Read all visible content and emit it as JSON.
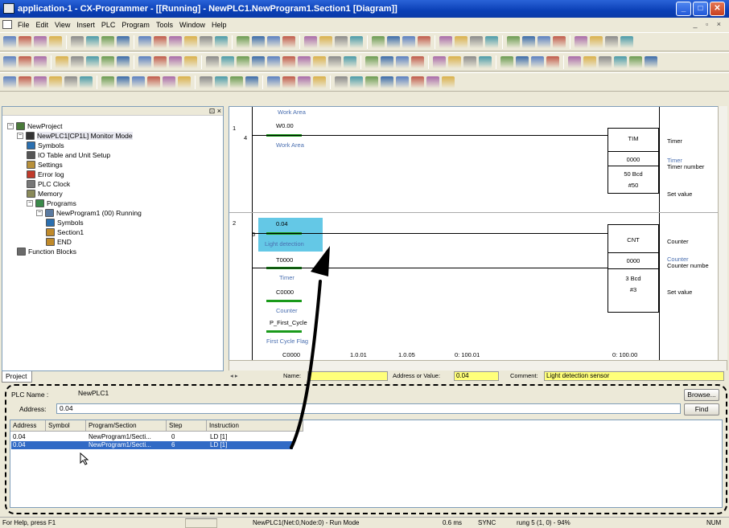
{
  "window": {
    "title": "application-1 - CX-Programmer - [[Running] - NewPLC1.NewProgram1.Section1 [Diagram]]",
    "controls": [
      "minimize",
      "maximize",
      "close"
    ]
  },
  "menu": [
    "File",
    "Edit",
    "View",
    "Insert",
    "PLC",
    "Program",
    "Tools",
    "Window",
    "Help"
  ],
  "tree": {
    "items": [
      {
        "label": "NewProject",
        "level": 0,
        "expanded": true,
        "icon": "project-icon"
      },
      {
        "label": "NewPLC1[CP1L] Monitor Mode",
        "level": 1,
        "expanded": true,
        "icon": "plc-icon"
      },
      {
        "label": "Symbols",
        "level": 2,
        "icon": "symbols-icon"
      },
      {
        "label": "IO Table and Unit Setup",
        "level": 2,
        "icon": "io-table-icon"
      },
      {
        "label": "Settings",
        "level": 2,
        "icon": "settings-icon"
      },
      {
        "label": "Error log",
        "level": 2,
        "icon": "error-log-icon"
      },
      {
        "label": "PLC Clock",
        "level": 2,
        "icon": "clock-icon"
      },
      {
        "label": "Memory",
        "level": 2,
        "icon": "memory-icon"
      },
      {
        "label": "Programs",
        "level": 2,
        "expanded": true,
        "icon": "programs-icon"
      },
      {
        "label": "NewProgram1 (00) Running",
        "level": 3,
        "expanded": true,
        "icon": "program-icon"
      },
      {
        "label": "Symbols",
        "level": 4,
        "icon": "symbols-icon"
      },
      {
        "label": "Section1",
        "level": 4,
        "icon": "section-icon"
      },
      {
        "label": "END",
        "level": 4,
        "icon": "end-icon"
      },
      {
        "label": "Function Blocks",
        "level": 1,
        "icon": "function-blocks-icon"
      }
    ],
    "tab": "Project"
  },
  "ladder": {
    "header_label": "Work Area",
    "rung1": {
      "rung_no": "1",
      "step": "4",
      "contact_addr": "W0.00",
      "contact_comment": "Work Area",
      "block": {
        "name": "TIM",
        "number": "0000",
        "bcd": "50 Bcd",
        "sv": "#50"
      },
      "right_labels": [
        "Timer",
        "Timer",
        "Timer number",
        "Set value"
      ]
    },
    "rung2": {
      "rung_no": "2",
      "step": "6",
      "contact1_addr": "0.04",
      "contact1_comment": "Light detection",
      "contact2_addr": "T0000",
      "contact2_comment": "Timer",
      "contact3_addr": "C0000",
      "contact3_comment": "Counter",
      "contact4_addr": "P_First_Cycle",
      "contact4_comment": "First Cycle Flag",
      "block": {
        "name": "CNT",
        "number": "0000",
        "bcd": "3 Bcd",
        "sv": "#3"
      },
      "right_labels": [
        "Counter",
        "Counter",
        "Counter numbe",
        "Set value"
      ]
    },
    "bottom_row": [
      "C0000",
      "1.0.01",
      "1.0.05",
      "0: 100.01",
      "0: 100.00"
    ]
  },
  "infobar": {
    "name_label": "Name:",
    "name_value": "",
    "address_label": "Address or Value:",
    "address_value": "0.04",
    "comment_label": "Comment:",
    "comment_value": "Light detection sensor"
  },
  "search": {
    "plc_name_label": "PLC Name :",
    "plc_name_value": "NewPLC1",
    "address_label": "Address:",
    "address_value": "0.04",
    "browse_label": "Browse...",
    "find_label": "Find",
    "columns": [
      "Address",
      "Symbol",
      "Program/Section",
      "Step",
      "Instruction"
    ],
    "rows": [
      {
        "address": "0.04",
        "symbol": "",
        "program": "NewProgram1/Secti...",
        "step": "0",
        "instruction": "LD [1]"
      },
      {
        "address": "0.04",
        "symbol": "",
        "program": "NewProgram1/Secti...",
        "step": "6",
        "instruction": "LD [1]"
      }
    ]
  },
  "status": {
    "help": "For Help, press F1",
    "plc": "NewPLC1(Net:0,Node:0) - Run Mode",
    "cycle": "0.6 ms",
    "sync": "SYNC",
    "rung": "rung 5 (1, 0) - 94%",
    "num": "NUM"
  },
  "colors": {
    "titlebar": "#0a3fb6",
    "selection": "#316ac5",
    "contact_highlight": "#64c8e6",
    "info_yellow": "#ffff7a"
  }
}
